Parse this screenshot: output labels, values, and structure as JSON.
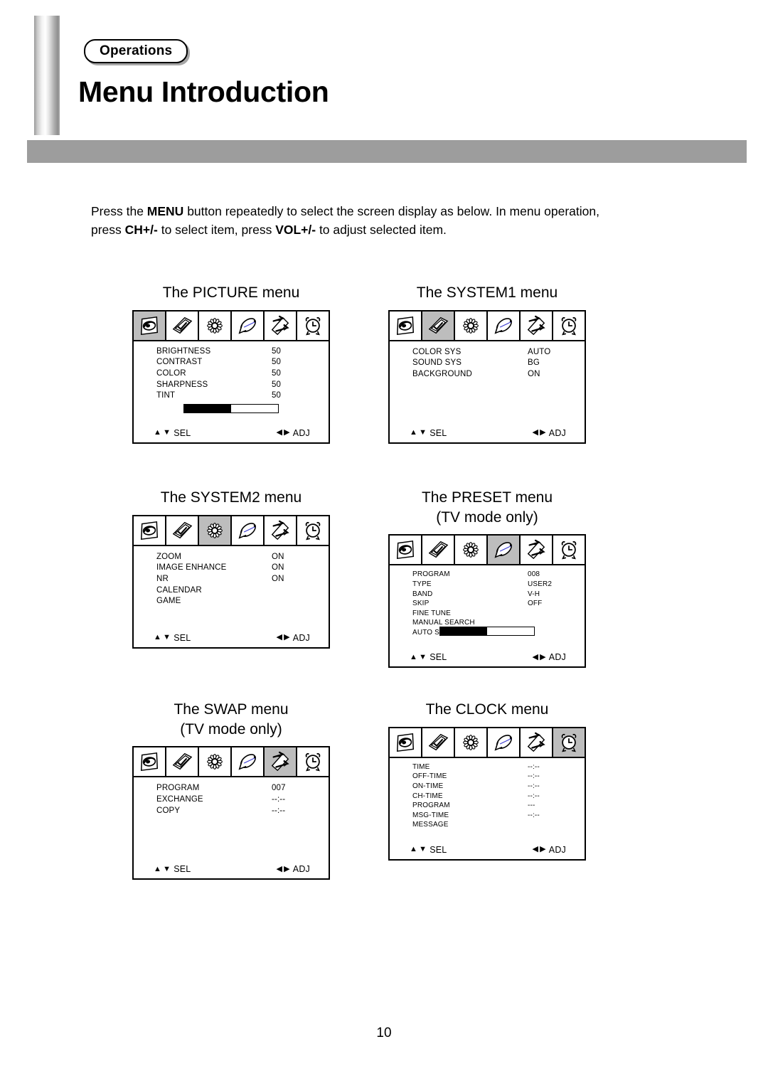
{
  "header": {
    "badge": "Operations",
    "title": "Menu Introduction"
  },
  "intro": {
    "part1": "Press the ",
    "bold1": "MENU",
    "part2": " button repeatedly to select the screen display as below. In menu operation, press ",
    "bold2": "CH+/-",
    "part3": " to select item, press ",
    "bold3": "VOL+/-",
    "part4": " to adjust selected item."
  },
  "footer": {
    "page_number": "10"
  },
  "osd_common": {
    "sel_label": "SEL",
    "adj_label": "ADJ",
    "up_arrow": "▲",
    "down_arrow": "▼",
    "left_arrow": "◀",
    "right_arrow": "▶",
    "icons": [
      "picture-icon",
      "contrast-icon",
      "flower-icon",
      "satellite-dish-icon",
      "swap-arrows-icon",
      "alarm-clock-icon"
    ]
  },
  "menus": [
    {
      "id": "picture",
      "caption": "The PICTURE menu",
      "selected_icon_index": 0,
      "rows": [
        {
          "label": "BRIGHTNESS",
          "value": "50"
        },
        {
          "label": "CONTRAST",
          "value": "50"
        },
        {
          "label": "COLOR",
          "value": "50"
        },
        {
          "label": "SHARPNESS",
          "value": "50"
        },
        {
          "label": "TINT",
          "value": "50"
        }
      ],
      "bar": {
        "visible": true,
        "fill_percent": 50
      }
    },
    {
      "id": "system1",
      "caption": "The SYSTEM1 menu",
      "selected_icon_index": 1,
      "rows": [
        {
          "label": "COLOR SYS",
          "value": "AUTO"
        },
        {
          "label": "SOUND SYS",
          "value": "BG"
        },
        {
          "label": "BACKGROUND",
          "value": "ON"
        }
      ],
      "bar": {
        "visible": false,
        "fill_percent": 0
      }
    },
    {
      "id": "system2",
      "caption": "The SYSTEM2 menu",
      "selected_icon_index": 2,
      "rows": [
        {
          "label": "ZOOM",
          "value": "ON"
        },
        {
          "label": "IMAGE ENHANCE",
          "value": "ON"
        },
        {
          "label": "NR",
          "value": "ON"
        },
        {
          "label": "CALENDAR",
          "value": ""
        },
        {
          "label": "GAME",
          "value": ""
        }
      ],
      "bar": {
        "visible": false,
        "fill_percent": 0
      }
    },
    {
      "id": "preset",
      "caption": "The PRESET menu\n(TV mode only)",
      "selected_icon_index": 3,
      "rows": [
        {
          "label": "PROGRAM",
          "value": "008"
        },
        {
          "label": "TYPE",
          "value": "USER2"
        },
        {
          "label": "BAND",
          "value": "V-H"
        },
        {
          "label": "SKIP",
          "value": "OFF"
        },
        {
          "label": "FINE TUNE",
          "value": ""
        },
        {
          "label": "MANUAL SEARCH",
          "value": ""
        },
        {
          "label": "AUTO SEARCH",
          "value": ""
        }
      ],
      "bar": {
        "visible": true,
        "fill_percent": 50
      }
    },
    {
      "id": "swap",
      "caption": "The SWAP menu\n(TV mode only)",
      "selected_icon_index": 4,
      "rows": [
        {
          "label": "PROGRAM",
          "value": "007"
        },
        {
          "label": "EXCHANGE",
          "value": "--:--"
        },
        {
          "label": "COPY",
          "value": "--:--"
        }
      ],
      "bar": {
        "visible": false,
        "fill_percent": 0
      }
    },
    {
      "id": "clock",
      "caption": "The CLOCK menu",
      "selected_icon_index": 5,
      "rows": [
        {
          "label": "TIME",
          "value": "--:--"
        },
        {
          "label": "OFF-TIME",
          "value": "--:--"
        },
        {
          "label": "ON-TIME",
          "value": "--:--"
        },
        {
          "label": "CH-TIME",
          "value": "--:--"
        },
        {
          "label": "PROGRAM",
          "value": "---"
        },
        {
          "label": "MSG-TIME",
          "value": "--:--"
        },
        {
          "label": "MESSAGE",
          "value": ""
        }
      ],
      "bar": {
        "visible": false,
        "fill_percent": 0
      }
    }
  ]
}
